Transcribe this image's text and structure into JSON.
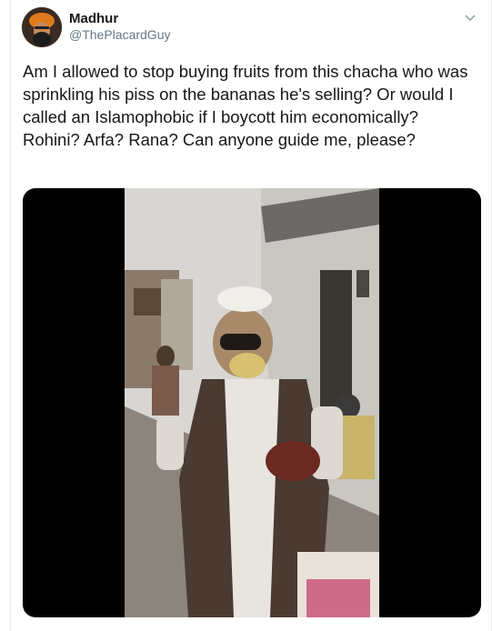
{
  "user": {
    "name": "Madhur",
    "handle": "@ThePlacardGuy"
  },
  "tweet": {
    "text": "Am I allowed to stop buying fruits from this chacha who was sprinkling his piss on the bananas he's selling? Or would I called an Islamophobic if I boycott him economically? Rohini? Arfa? Rana? Can anyone guide me, please?"
  },
  "icons": {
    "menu": "chevron-down-icon"
  },
  "colors": {
    "text": "#14171a",
    "secondary": "#657786",
    "border": "#e6ecf0",
    "media_bg": "#000000"
  }
}
